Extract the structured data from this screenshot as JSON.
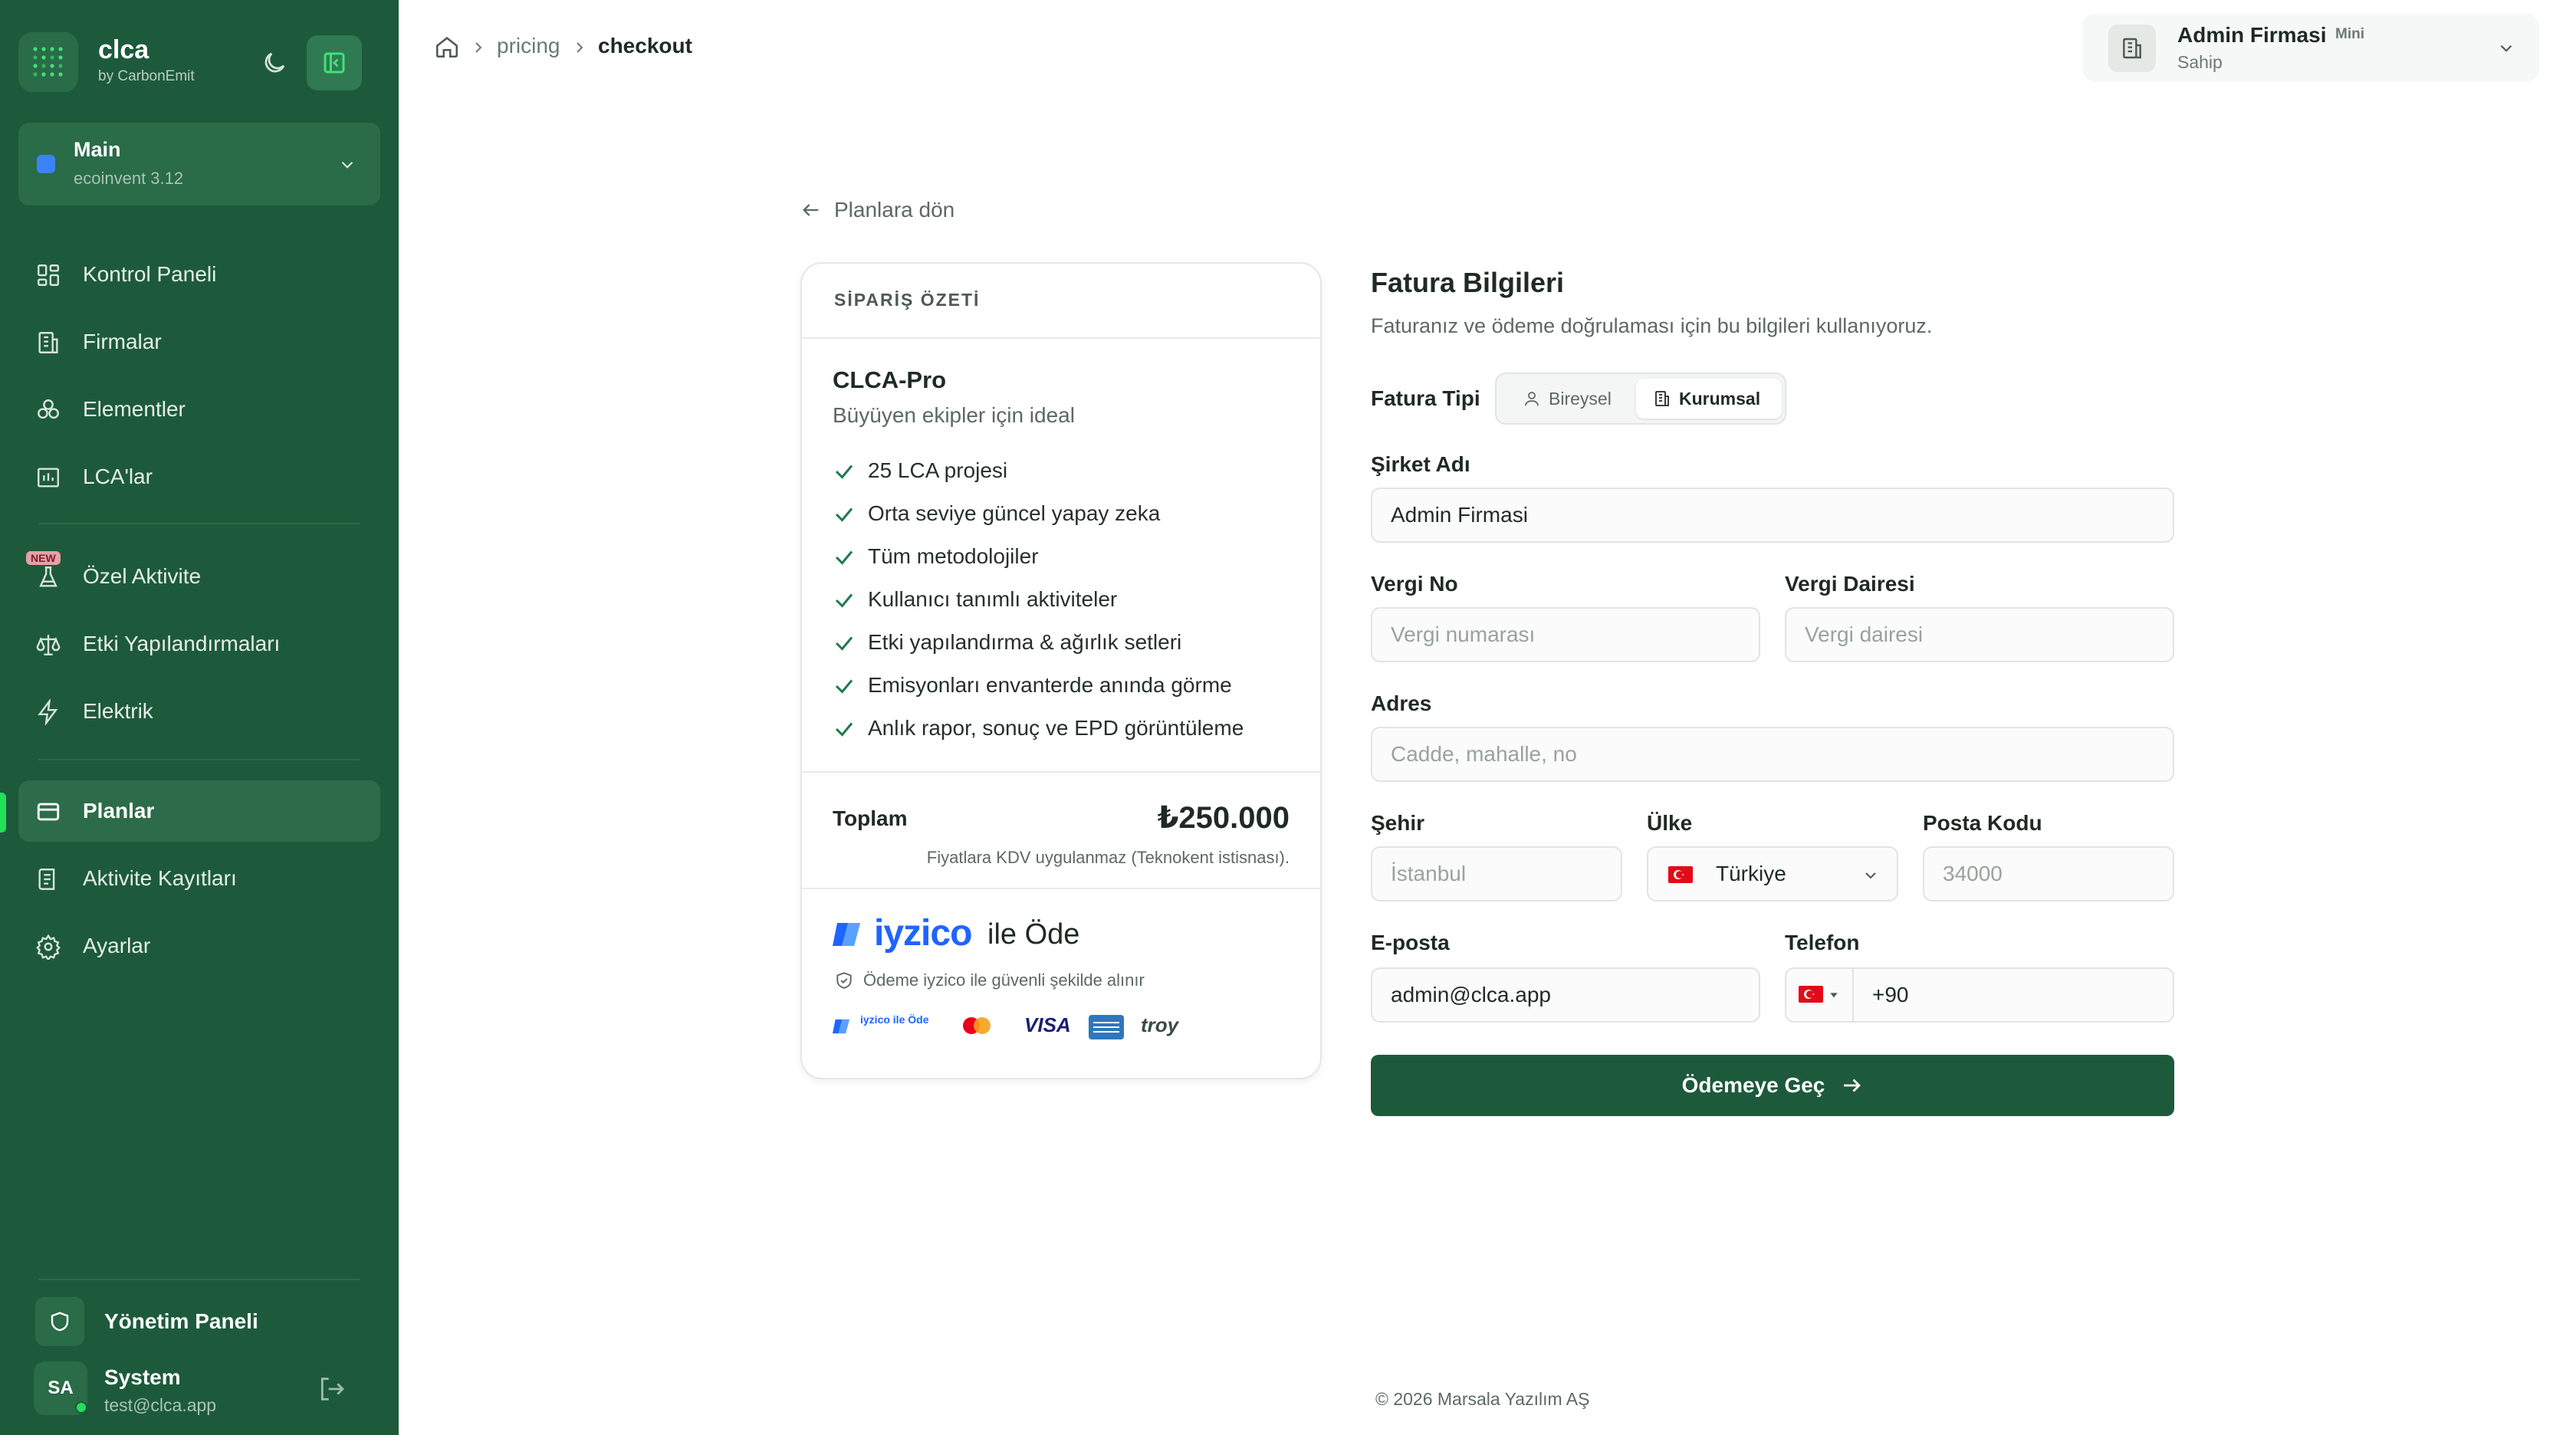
{
  "app": {
    "name": "clca",
    "by": "by CarbonEmit"
  },
  "workspace": {
    "name": "Main",
    "database": "ecoinvent 3.12"
  },
  "nav": {
    "items": [
      {
        "label": "Kontrol Paneli",
        "icon": "dashboard-icon"
      },
      {
        "label": "Firmalar",
        "icon": "building-icon"
      },
      {
        "label": "Elementler",
        "icon": "elements-icon"
      },
      {
        "label": "LCA'lar",
        "icon": "chart-icon"
      },
      {
        "label": "Özel Aktivite",
        "icon": "flask-icon",
        "badge": "NEW"
      },
      {
        "label": "Etki Yapılandırmaları",
        "icon": "scale-icon"
      },
      {
        "label": "Elektrik",
        "icon": "bolt-icon"
      },
      {
        "label": "Planlar",
        "icon": "card-icon",
        "active": true
      },
      {
        "label": "Aktivite Kayıtları",
        "icon": "log-icon"
      },
      {
        "label": "Ayarlar",
        "icon": "gear-icon"
      }
    ],
    "admin_label": "Yönetim Paneli",
    "user": {
      "initials": "SA",
      "name": "System",
      "email": "test@clca.app"
    }
  },
  "breadcrumb": {
    "items": [
      "pricing",
      "checkout"
    ]
  },
  "org": {
    "name": "Admin Firmasi",
    "plan_badge": "Mini",
    "role": "Sahip"
  },
  "back_link": "Planlara dön",
  "order": {
    "heading": "SİPARİŞ ÖZETİ",
    "plan_name": "CLCA-Pro",
    "plan_desc": "Büyüyen ekipler için ideal",
    "features": [
      "25 LCA projesi",
      "Orta seviye güncel yapay zeka",
      "Tüm metodolojiler",
      "Kullanıcı tanımlı aktiviteler",
      "Etki yapılandırma & ağırlık setleri",
      "Emisyonları envanterde anında görme",
      "Anlık rapor, sonuç ve EPD görüntüleme"
    ],
    "total_label": "Toplam",
    "total_value": "₺250.000",
    "vat_note": "Fiyatlara KDV uygulanmaz (Teknokent istisnası).",
    "pay_brand": "iyzico",
    "pay_suffix": "ile Öde",
    "secure_note": "Ödeme iyzico ile güvenli şekilde alınır",
    "card_logos": [
      "iyzico ile Öde",
      "Mastercard",
      "VISA",
      "American Express",
      "troy"
    ]
  },
  "form": {
    "title": "Fatura Bilgileri",
    "subtitle": "Faturanız ve ödeme doğrulaması için bu bilgileri kullanıyoruz.",
    "type_label": "Fatura Tipi",
    "type_options": [
      "Bireysel",
      "Kurumsal"
    ],
    "type_selected": "Kurumsal",
    "company_label": "Şirket Adı",
    "company_value": "Admin Firmasi",
    "tax_no_label": "Vergi No",
    "tax_no_placeholder": "Vergi numarası",
    "tax_office_label": "Vergi Dairesi",
    "tax_office_placeholder": "Vergi dairesi",
    "address_label": "Adres",
    "address_placeholder": "Cadde, mahalle, no",
    "city_label": "Şehir",
    "city_placeholder": "İstanbul",
    "country_label": "Ülke",
    "country_value": "Türkiye",
    "postal_label": "Posta Kodu",
    "postal_placeholder": "34000",
    "email_label": "E-posta",
    "email_value": "admin@clca.app",
    "phone_label": "Telefon",
    "phone_value": "+90",
    "submit_label": "Ödemeye Geç"
  },
  "footer": "© 2026 Marsala Yazılım AŞ",
  "colors": {
    "sidebar": "#1d5a3b",
    "accent": "#22e05a",
    "primary_button": "#1d5a3b",
    "check": "#1f7a4c"
  }
}
